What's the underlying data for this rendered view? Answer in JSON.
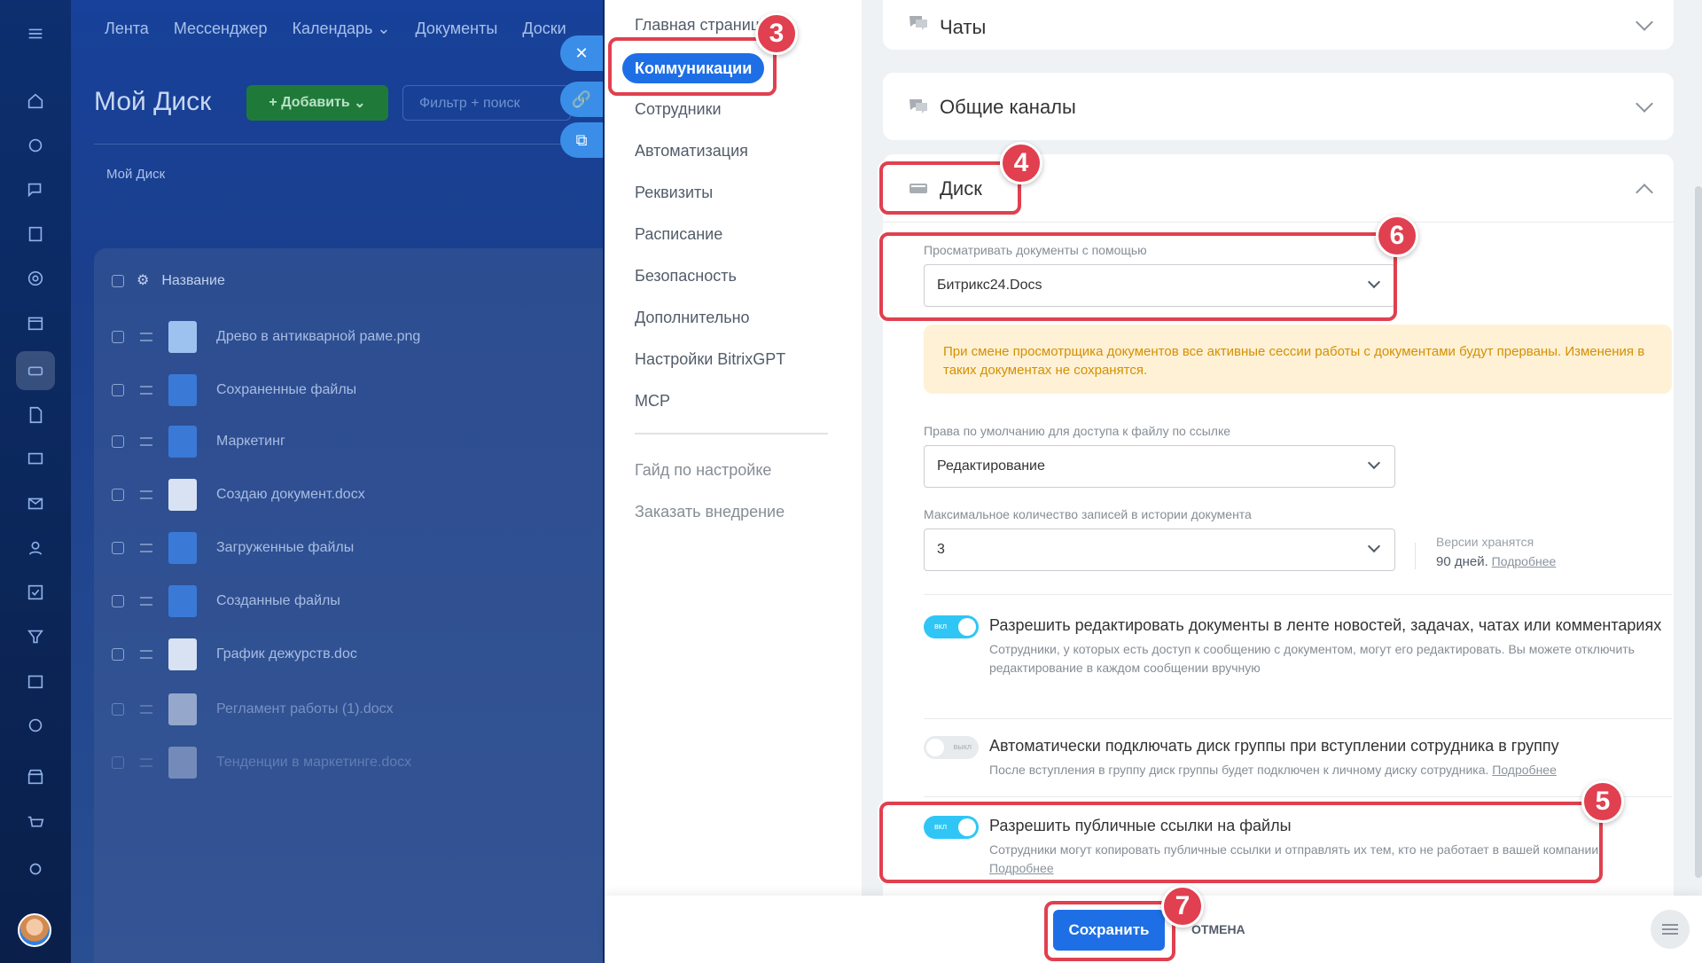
{
  "background_app": {
    "nav": [
      "Лента",
      "Мессенджер",
      "Календарь",
      "Документы",
      "Доски"
    ],
    "title": "Мой Диск",
    "add_label": "+ Добавить",
    "filter_placeholder": "Фильтр + поиск",
    "breadcrumb": "Мой Диск",
    "column_name": "Название",
    "files": [
      {
        "name": "Древо в антикварной раме.png",
        "kind": "image"
      },
      {
        "name": "Сохраненные файлы",
        "kind": "folder"
      },
      {
        "name": "Маркетинг",
        "kind": "folder"
      },
      {
        "name": "Создаю документ.docx",
        "kind": "doc"
      },
      {
        "name": "Загруженные файлы",
        "kind": "folder"
      },
      {
        "name": "Созданные файлы",
        "kind": "folder"
      },
      {
        "name": "График дежурств.doc",
        "kind": "doc"
      },
      {
        "name": "Регламент работы (1).docx",
        "kind": "doc"
      },
      {
        "name": "Тенденции в маркетинге.docx",
        "kind": "doc"
      }
    ]
  },
  "settings_nav": {
    "items": [
      "Главная страница",
      "Коммуникации",
      "Сотрудники",
      "Автоматизация",
      "Реквизиты",
      "Расписание",
      "Безопасность",
      "Дополнительно",
      "Настройки BitrixGPT",
      "MCP"
    ],
    "selected": "Коммуникации",
    "footer_links": [
      "Гайд по настройке",
      "Заказать внедрение"
    ]
  },
  "sections": {
    "chats": "Чаты",
    "channels": "Общие каналы",
    "disk": "Диск"
  },
  "disk": {
    "viewer_label": "Просматривать документы с помощью",
    "viewer_value": "Битрикс24.Docs",
    "warning": "При смене просмотрщика документов все активные сессии работы с документами будут прерваны. Изменения в таких документах не сохранятся.",
    "rights_label": "Права по умолчанию для доступа к файлу по ссылке",
    "rights_value": "Редактирование",
    "history_label": "Максимальное количество записей в истории документа",
    "history_value": "3",
    "versions_note": "Версии хранятся",
    "versions_days": "90 дней.",
    "more": "Подробнее",
    "options": [
      {
        "on": true,
        "toggle_text": "вкл",
        "title": "Разрешить редактировать документы в ленте новостей, задачах, чатах или комментариях",
        "desc": "Сотрудники, у которых есть доступ к сообщению с документом, могут его редактировать. Вы можете отключить редактирование в каждом сообщении вручную"
      },
      {
        "on": false,
        "toggle_text": "выкл",
        "title": "Автоматически подключать диск группы при вступлении сотрудника в группу",
        "desc": "После вступления в группу диск группы будет подключен к личному диску сотрудника.",
        "link": "Подробнее"
      },
      {
        "on": true,
        "toggle_text": "вкл",
        "title": "Разрешить публичные ссылки на файлы",
        "desc": "Сотрудники могут копировать публичные ссылки и отправлять их тем, кто не работает в вашей компании.",
        "link": "Подробнее"
      }
    ]
  },
  "footer": {
    "save": "Сохранить",
    "cancel": "ОТМЕНА"
  },
  "badges": [
    "3",
    "4",
    "5",
    "6",
    "7"
  ],
  "colors": {
    "accent": "#1e6fe6",
    "toggle_on": "#2fc6f6",
    "annotation": "#e0404f",
    "warning_bg": "#fff1d6",
    "warning_text": "#d49000"
  }
}
